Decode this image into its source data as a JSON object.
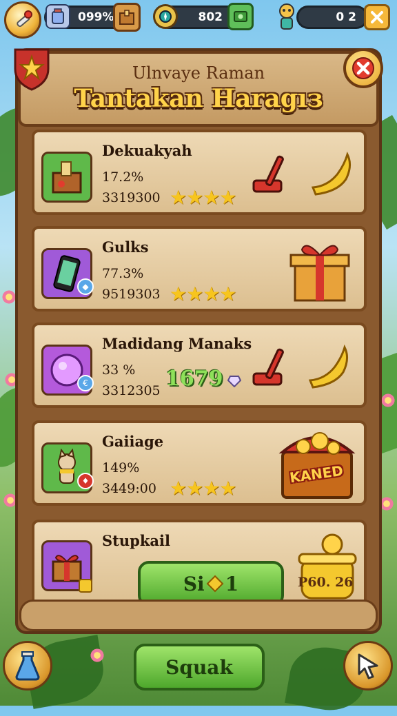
{
  "top_bar": {
    "currency1_value": "099%",
    "currency2_value": "802",
    "currency3_value": "0 2",
    "left_icon": "wrench-icon",
    "currency1_icon": "jar-icon",
    "currency1_box_icon": "box-icon",
    "currency2_icon": "compass-icon",
    "currency2_box_icon": "cash-icon",
    "currency3_icon": "character-icon",
    "close_icon": "close-icon"
  },
  "header": {
    "subtitle": "Ulnvaye Raman",
    "title": "Tantakan Haragıз",
    "badge_icon": "star-shield-icon",
    "close_icon": "close-icon"
  },
  "items": [
    {
      "name": "Dekuakyah",
      "percent": "17.2%",
      "value": "3319300",
      "stars": 4,
      "icon": "treasure-box-icon",
      "reward": "lever-and-horn"
    },
    {
      "name": "Gulks",
      "percent": "77.3%",
      "value": "9519303",
      "stars": 4,
      "icon": "phone-icon",
      "reward": "gift-box"
    },
    {
      "name": "Madidang Manaks",
      "percent": "33 %",
      "value": "3312305",
      "extra_value": "1679",
      "icon": "orb-icon",
      "reward": "lever-and-horn"
    },
    {
      "name": "Gaiiage",
      "percent": "149%",
      "value": "3449:00",
      "stars": 4,
      "icon": "cat-icon",
      "reward": "treasure-chest",
      "reward_label": "KANED"
    }
  ],
  "special": {
    "name": "Stupkail",
    "button_label_left": "Si",
    "button_label_right": "1",
    "price": "P60. 26",
    "icon": "gift-crate-icon",
    "reward": "gold-pot"
  },
  "bottom": {
    "main_button": "Squak",
    "left_icon": "potion-icon",
    "right_icon": "cursor-icon"
  },
  "colors": {
    "wood": "#8a5a2f",
    "plank": "#eed9b5",
    "gold": "#ffd34a",
    "green_button": "#6bc23a",
    "star": "#f7c51e",
    "close_red": "#e23b2e"
  }
}
